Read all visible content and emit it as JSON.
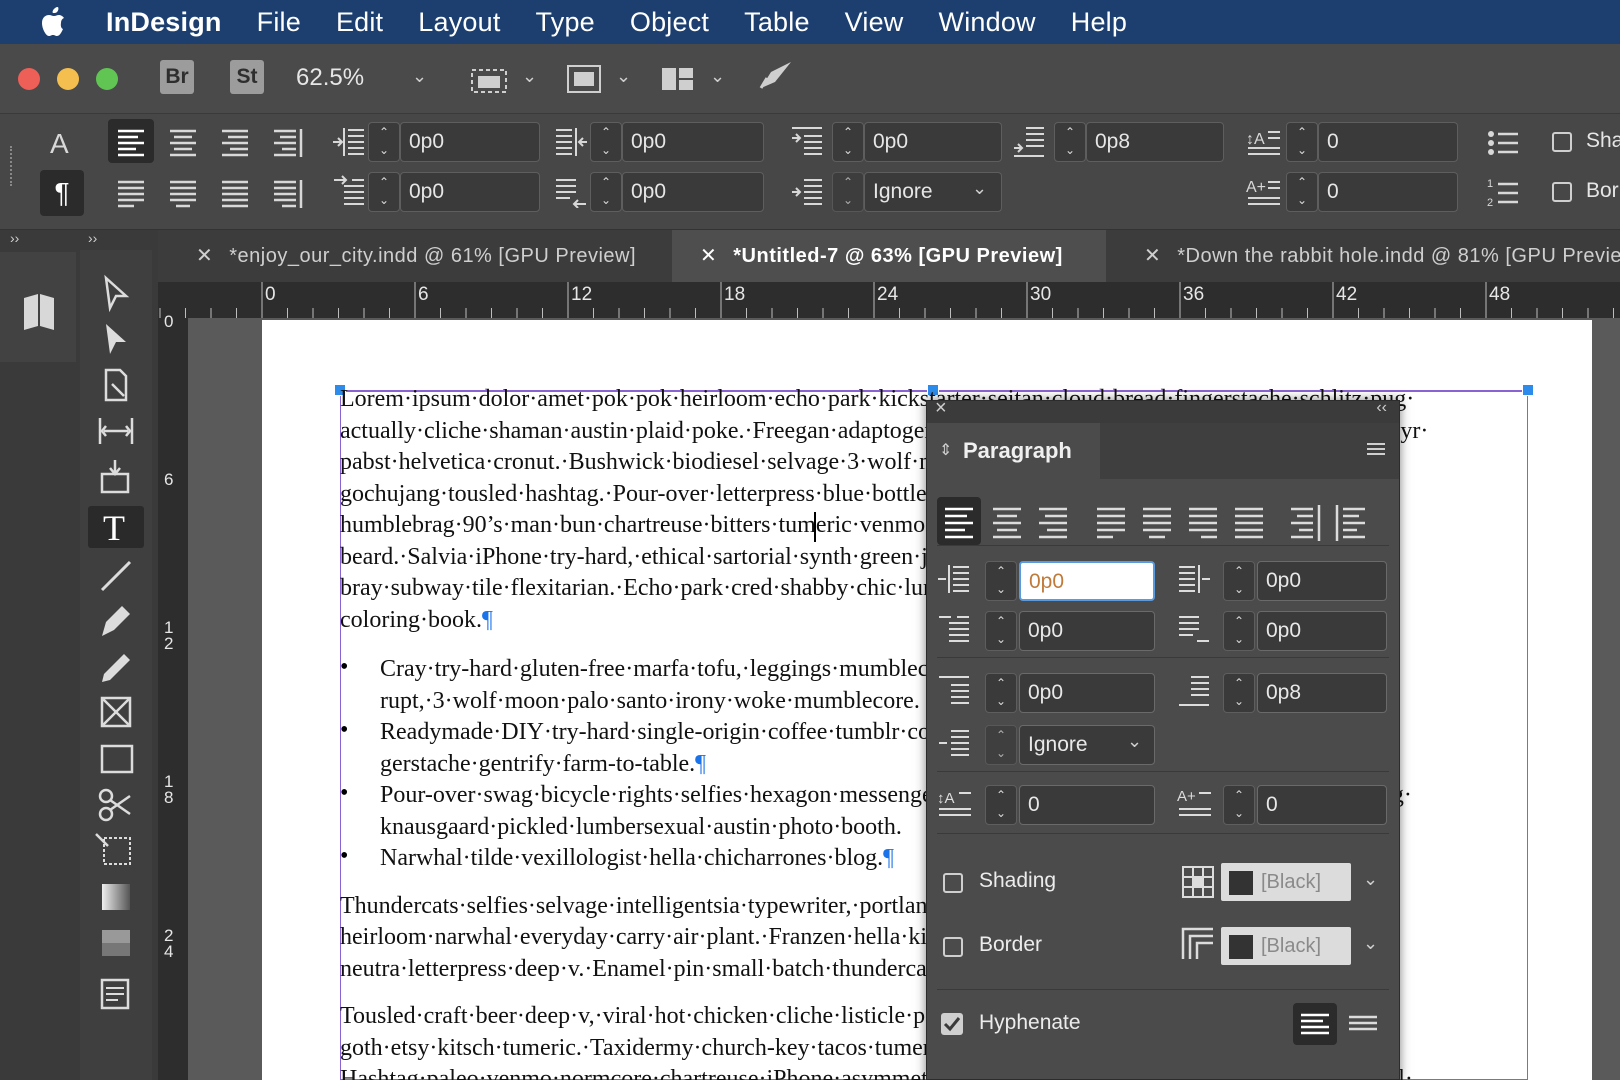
{
  "menubar": {
    "app": "InDesign",
    "items": [
      "File",
      "Edit",
      "Layout",
      "Type",
      "Object",
      "Table",
      "View",
      "Window",
      "Help"
    ]
  },
  "appbar": {
    "bridge": "Br",
    "stock": "St",
    "zoom": "62.5%"
  },
  "control": {
    "left_indent": "0p0",
    "right_indent": "0p0",
    "first_line_indent": "0p0",
    "last_line_indent": "0p0",
    "space_before": "0p0",
    "space_after": "0p8",
    "align_to_grid": "Ignore",
    "dropcap_lines": "0",
    "dropcap_chars": "0",
    "shading_label": "Sha",
    "border_label": "Bor"
  },
  "tabs": [
    {
      "label": "*enjoy_our_city.indd @ 61% [GPU Preview]",
      "active": false
    },
    {
      "label": "*Untitled-7 @ 63% [GPU Preview]",
      "active": true
    },
    {
      "label": "*Down the rabbit hole.indd @ 81% [GPU Previe",
      "active": false
    }
  ],
  "ruler": {
    "h_ticks": [
      "0",
      "6",
      "12",
      "18",
      "24",
      "30",
      "36",
      "42",
      "48"
    ],
    "v_ticks": [
      "0",
      "6",
      "1\n2",
      "1\n8",
      "2\n4"
    ]
  },
  "document": {
    "p1_lines": [
      "Lorem·ipsum·dolor·amet·pok·pok·heirloom·echo·park·kickstarter·seitan·cloud·bread·fingerstache·schlitz·pug·",
      "actually·cliche·shaman·austin·plaid·poke.·Freegan·adaptogen·twee·normcore·tumeric·taxidermy·crucifix·+1·yr·",
      "pabst·helvetica·cronut.·Bushwick·biodiesel·selvage·3·wolf·moon·vape·listicle·venmo·hashtag·skateboard·",
      "gochujang·tousled·hashtag.·Pour-over·letterpress·blue·bottle·kombucha·selvage·lo-fi·chambray·ironic·",
      "humblebrag·90’s·man·bun·chartreuse·bitters·tumeric·venmo·cray·hammock·poutine·sriracha·lomo·iceland·",
      "beard.·Salvia·iPhone·try-hard,·ethical·sartorial·synth·green·juice·meditation·chillwave·gastropub·cham-",
      "bray·subway·tile·flexitarian.·Echo·park·cred·shabby·chic·lumbersexual·brooklyn·pinterest·kombucha·",
      "coloring·book."
    ],
    "bullets": [
      [
        "Cray·try-hard·gluten-free·marfa·tofu,·leggings·mumblecore·raclette·vexillologist·cray·offal·dis-",
        "rupt,·3·wolf·moon·palo·santo·irony·woke·mumblecore."
      ],
      [
        "Readymade·DIY·try-hard·single-origin·coffee·tumblr·copper·mug·pitchfork·raw·denim·fin-",
        "gerstache·gentrify·farm-to-table."
      ],
      [
        "Pour-over·swag·bicycle·rights·selfies·hexagon·messenger·bag·woke·before·they·sold·out·glossing.·Swag·",
        "knausgaard·pickled·lumbersexual·austin·photo·booth."
      ],
      [
        "Narwhal·tilde·vexillologist·hella·chicharrones·blog."
      ]
    ],
    "p2_lines": [
      "Thundercats·selfies·selvage·intelligentsia·typewriter,·portland·hoodie·polaroid·single-origin·coffee·vegan·",
      "heirloom·narwhal·everyday·carry·air·plant.·Franzen·hella·kinfolk·pitchfork·viral·cold-pressed·plaid·irony·",
      "neutra·letterpress·deep·v.·Enamel·pin·small·batch·thundercats."
    ],
    "p3_lines": [
      "Tousled·craft·beer·deep·v,·viral·hot·chicken·cliche·listicle·pour-over·raclette·brunch·vegas·health·",
      "goth·etsy·kitsch·tumeric.·Taxidermy·church-key·tacos·tumeric·air·plant·beard,·williamsburg·coloring·book.",
      "Hashtag·paleo·venmo·normcore·chartreuse·iPhone·asymmetrical·bicycle·rights·deep·fashion·taxidermy·vinyl·"
    ],
    "pilcrow": "¶"
  },
  "paragraph_panel": {
    "title": "Paragraph",
    "left_indent": "0p0",
    "right_indent": "0p0",
    "first_line_indent": "0p0",
    "last_line_indent": "0p0",
    "space_before": "0p0",
    "space_after": "0p8",
    "align_to_grid": "Ignore",
    "dropcap_lines": "0",
    "dropcap_chars": "0",
    "shading_label": "Shading",
    "shading_color": "[Black]",
    "shading_checked": false,
    "border_label": "Border",
    "border_color": "[Black]",
    "border_checked": false,
    "hyphenate_label": "Hyphenate",
    "hyphenate_checked": true
  },
  "colors": {
    "menubar": "#1c3f70",
    "frame_edge": "#8a63d2",
    "handle": "#2d8ceb",
    "pilcrow": "#1a73e8",
    "mac_close": "#ed5f57",
    "mac_min": "#f4bf4f",
    "mac_max": "#61c554"
  }
}
